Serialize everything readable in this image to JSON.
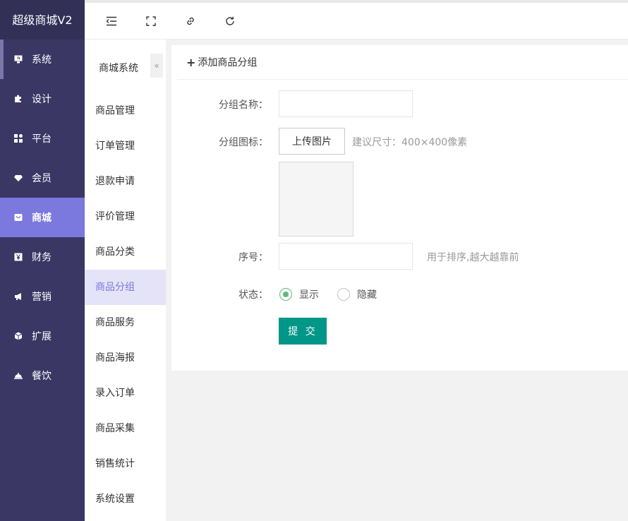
{
  "brand": "超级商城V2",
  "sidebar": {
    "items": [
      {
        "label": "系统",
        "icon": "monitor-icon"
      },
      {
        "label": "设计",
        "icon": "puzzle-icon"
      },
      {
        "label": "平台",
        "icon": "grid-icon"
      },
      {
        "label": "会员",
        "icon": "diamond-icon"
      },
      {
        "label": "商城",
        "icon": "shop-icon"
      },
      {
        "label": "财务",
        "icon": "yen-icon"
      },
      {
        "label": "营销",
        "icon": "megaphone-icon"
      },
      {
        "label": "扩展",
        "icon": "cube-icon"
      },
      {
        "label": "餐饮",
        "icon": "cloche-icon"
      }
    ],
    "active": "商城"
  },
  "topbar": {
    "icons": [
      "collapse-menu-icon",
      "fullscreen-icon",
      "link-icon",
      "refresh-icon"
    ]
  },
  "submenu": {
    "title": "商城系统",
    "collapse_glyph": "«",
    "items": [
      "商品管理",
      "订单管理",
      "退款申请",
      "评价管理",
      "商品分类",
      "商品分组",
      "商品服务",
      "商品海报",
      "录入订单",
      "商品采集",
      "销售统计",
      "系统设置"
    ],
    "active": "商品分组"
  },
  "form": {
    "header": "添加商品分组",
    "header_icon": "plus-icon",
    "name_label": "分组名称：",
    "name_value": "",
    "icon_label": "分组图标：",
    "upload_button": "上传图片",
    "size_hint": "建议尺寸：400×400像素",
    "sort_label": "序号：",
    "sort_value": "",
    "sort_hint": "用于排序,越大越靠前",
    "status_label": "状态：",
    "status_options": [
      {
        "label": "显示",
        "checked": true
      },
      {
        "label": "隐藏",
        "checked": false
      }
    ],
    "submit": "提 交"
  },
  "colors": {
    "sidebar_bg": "#3a3765",
    "sidebar_active": "#7b78de",
    "submenu_active_bg": "#e4e3f8",
    "submit_bg": "#009688",
    "radio_checked": "#5fb878"
  }
}
